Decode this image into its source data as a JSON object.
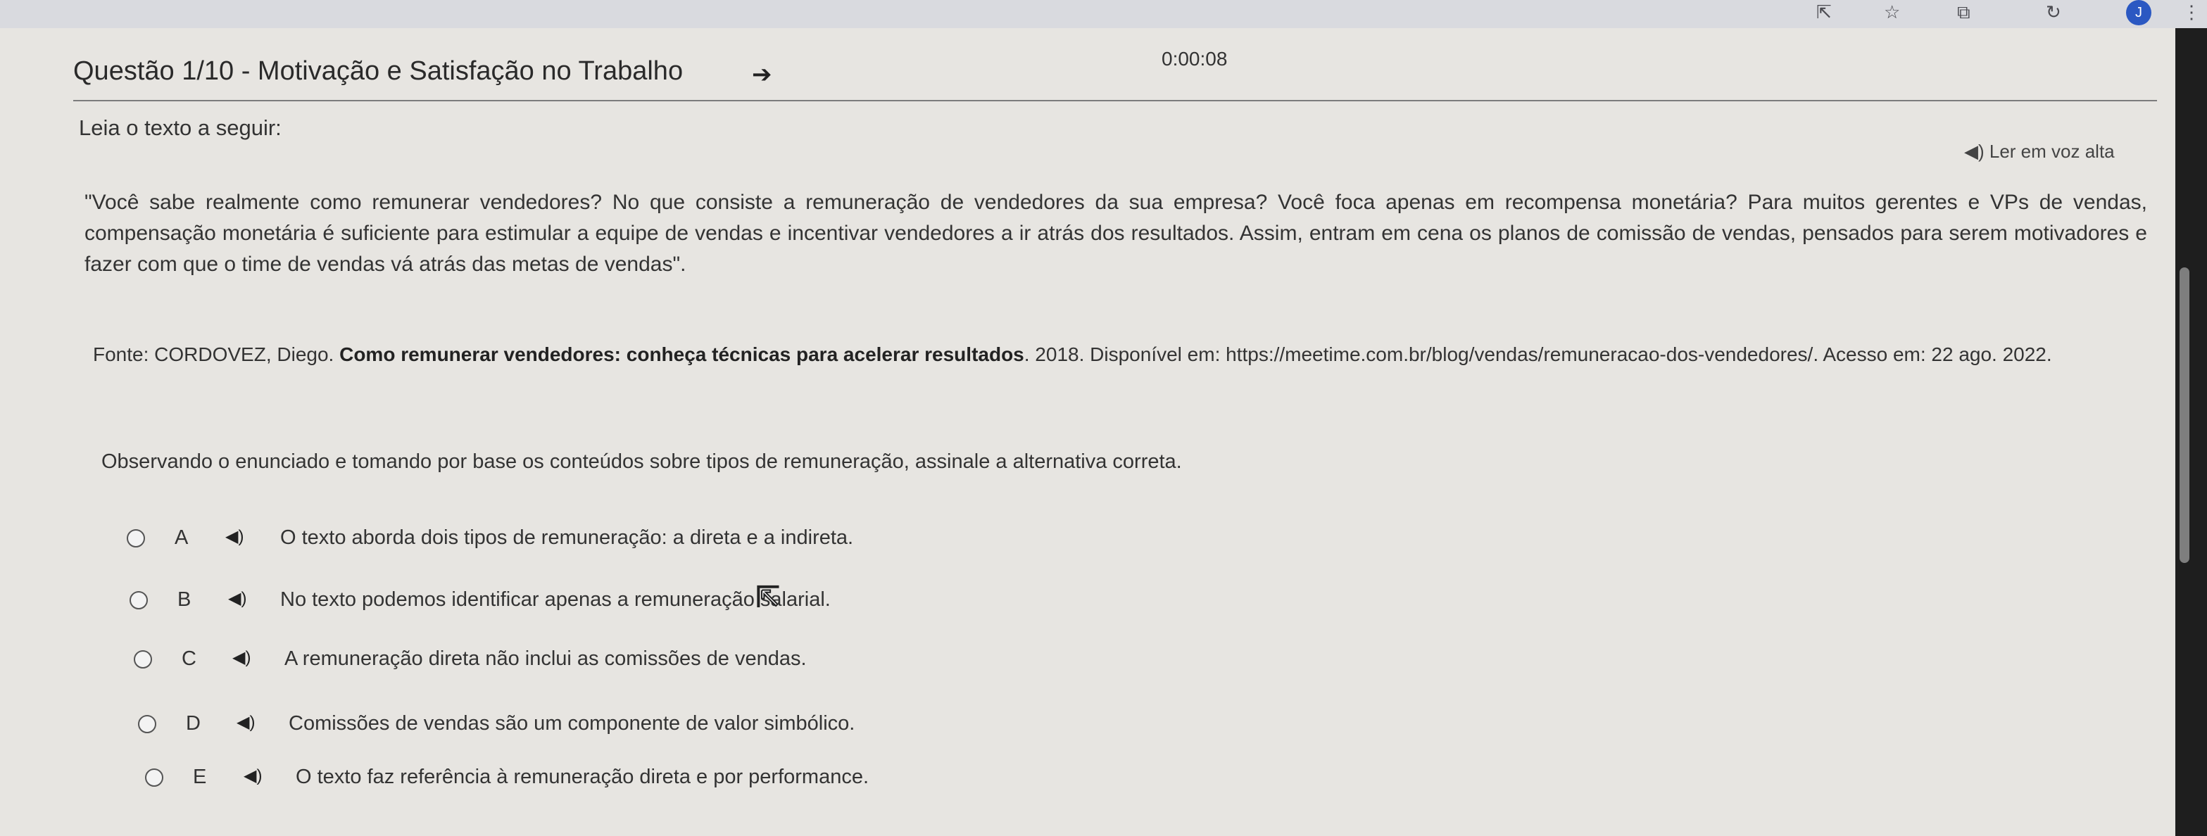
{
  "timer": "0:00:08",
  "question_title": "Questão 1/10 - Motivação e Satisfação no Trabalho",
  "arrow_icon": "➔",
  "lead_text": "Leia o texto a seguir:",
  "read_aloud_label": "◀) Ler em voz alta",
  "quote_text": "\"Você sabe realmente como remunerar vendedores? No que consiste a remuneração de vendedores da sua empresa? Você foca apenas em recompensa monetária? Para muitos gerentes e VPs de vendas, compensação monetária é suficiente para estimular a equipe de vendas e incentivar vendedores a ir atrás dos resultados. Assim, entram em cena os planos de comissão de vendas, pensados para serem motivadores e fazer com que o time de vendas vá atrás das metas de vendas\".",
  "source": {
    "prefix": "Fonte: CORDOVEZ, Diego. ",
    "bold": "Como remunerar vendedores: conheça técnicas para acelerar resultados",
    "suffix": ". 2018. Disponível em: https://meetime.com.br/blog/vendas/remuneracao-dos-vendedores/. Acesso em: 22 ago. 2022."
  },
  "prompt_text": "Observando o enunciado e tomando por base os conteúdos sobre tipos de remuneração, assinale a alternativa correta.",
  "options": [
    {
      "letter": "A",
      "text": "O texto aborda dois tipos de remuneração: a direta e a indireta."
    },
    {
      "letter": "B",
      "text": "No texto podemos identificar apenas a remuneração salarial."
    },
    {
      "letter": "C",
      "text": "A remuneração direta não inclui as comissões de vendas."
    },
    {
      "letter": "D",
      "text": "Comissões de vendas são um componente de valor simbólico."
    },
    {
      "letter": "E",
      "text": "O texto faz referência à remuneração direta e por performance."
    }
  ],
  "speaker_icon": "◀)",
  "browser": {
    "avatar_letter": "J",
    "icons": [
      "share-icon",
      "star-icon",
      "extensions-icon",
      "history-icon",
      "menu-icon"
    ]
  },
  "colors": {
    "page_bg": "#e7e5e1",
    "text": "#333333",
    "avatar": "#2b58c2"
  }
}
